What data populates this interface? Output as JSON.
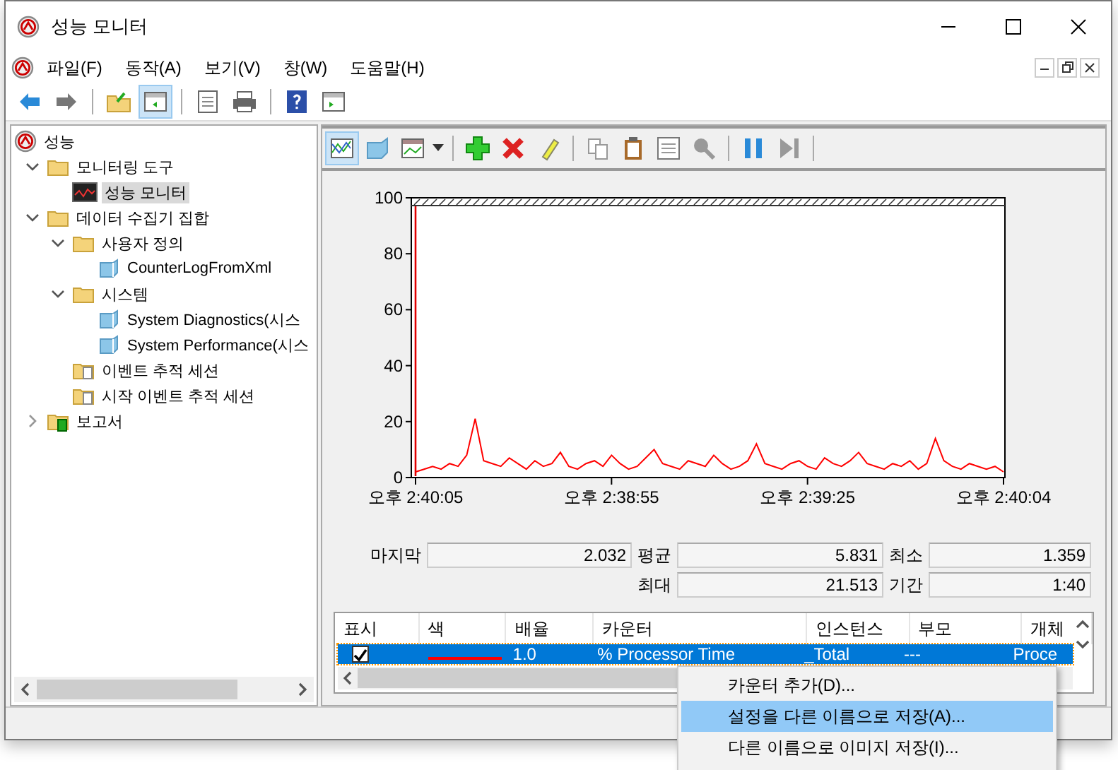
{
  "window": {
    "title": "성능 모니터"
  },
  "menu": [
    "파일(F)",
    "동작(A)",
    "보기(V)",
    "창(W)",
    "도움말(H)"
  ],
  "tree": [
    {
      "label": "성능",
      "kind": "app",
      "selected": false,
      "children": [
        {
          "label": "모니터링 도구",
          "kind": "folder",
          "expanded": true,
          "selected": false,
          "children": [
            {
              "label": "성능 모니터",
              "kind": "monitor",
              "selected": true
            }
          ]
        },
        {
          "label": "데이터 수집기 집합",
          "kind": "folder",
          "expanded": true,
          "selected": false,
          "children": [
            {
              "label": "사용자 정의",
              "kind": "folder",
              "expanded": true,
              "selected": false,
              "children": [
                {
                  "label": "CounterLogFromXml",
                  "kind": "set",
                  "selected": false
                }
              ]
            },
            {
              "label": "시스템",
              "kind": "folder",
              "expanded": true,
              "selected": false,
              "children": [
                {
                  "label": "System Diagnostics(시스",
                  "kind": "set",
                  "selected": false
                },
                {
                  "label": "System Performance(시스",
                  "kind": "set",
                  "selected": false
                }
              ]
            },
            {
              "label": "이벤트 추적 세션",
              "kind": "trace",
              "selected": false
            },
            {
              "label": "시작 이벤트 추적 세션",
              "kind": "trace",
              "selected": false
            }
          ]
        },
        {
          "label": "보고서",
          "kind": "report",
          "expanded": false,
          "selected": false
        }
      ]
    }
  ],
  "chart_data": {
    "type": "line",
    "ylim": [
      0,
      100
    ],
    "yticks": [
      0,
      20,
      40,
      60,
      80,
      100
    ],
    "categories": [
      "오후 2:40:05",
      null,
      null,
      null,
      null,
      null,
      null,
      null,
      null,
      null,
      null,
      null,
      null,
      null,
      null,
      null,
      null,
      null,
      null,
      null,
      null,
      null,
      null,
      "오후 2:38:55",
      null,
      null,
      null,
      null,
      null,
      null,
      null,
      null,
      null,
      null,
      null,
      null,
      null,
      null,
      null,
      null,
      null,
      null,
      null,
      null,
      null,
      null,
      "오후 2:39:25",
      null,
      null,
      null,
      null,
      null,
      null,
      null,
      null,
      null,
      null,
      null,
      null,
      null,
      null,
      null,
      null,
      null,
      null,
      null,
      null,
      null,
      null,
      "오후 2:40:04"
    ],
    "series": [
      {
        "color": "#ff0000",
        "values": [
          2,
          3,
          4,
          3,
          5,
          4,
          8,
          21,
          6,
          5,
          4,
          7,
          5,
          3,
          6,
          4,
          5,
          9,
          4,
          3,
          5,
          6,
          4,
          8,
          5,
          3,
          4,
          7,
          10,
          5,
          4,
          3,
          6,
          5,
          4,
          8,
          5,
          3,
          4,
          6,
          12,
          5,
          4,
          3,
          5,
          6,
          4,
          3,
          7,
          5,
          4,
          6,
          9,
          5,
          4,
          3,
          5,
          4,
          6,
          3,
          5,
          14,
          6,
          4,
          3,
          5,
          4,
          3,
          4,
          2
        ]
      }
    ]
  },
  "stats": [
    [
      {
        "label": "마지막",
        "value": "2.032"
      },
      {
        "label": "평균",
        "value": "5.831"
      },
      {
        "label": "최소",
        "value": "1.359"
      }
    ],
    [
      {
        "label": "최대",
        "value": "21.513"
      },
      {
        "label": "기간",
        "value": "1:40"
      }
    ]
  ],
  "counter_table": {
    "columns": [
      "표시",
      "색",
      "배율",
      "카운터",
      "인스턴스",
      "부모",
      "개체"
    ],
    "rows": [
      {
        "checked": true,
        "selected": true,
        "color": "#ff0000",
        "scale": "1.0",
        "counter": "% Processor Time",
        "instance": "_Total",
        "parent": "---",
        "object": "Proce"
      }
    ]
  },
  "context_menu": [
    {
      "label": "카운터 추가(D)...",
      "selected": false
    },
    {
      "label": "설정을 다른 이름으로 저장(A)...",
      "selected": true
    },
    {
      "label": "다른 이름으로 이미지 저장(I)...",
      "selected": false
    }
  ]
}
